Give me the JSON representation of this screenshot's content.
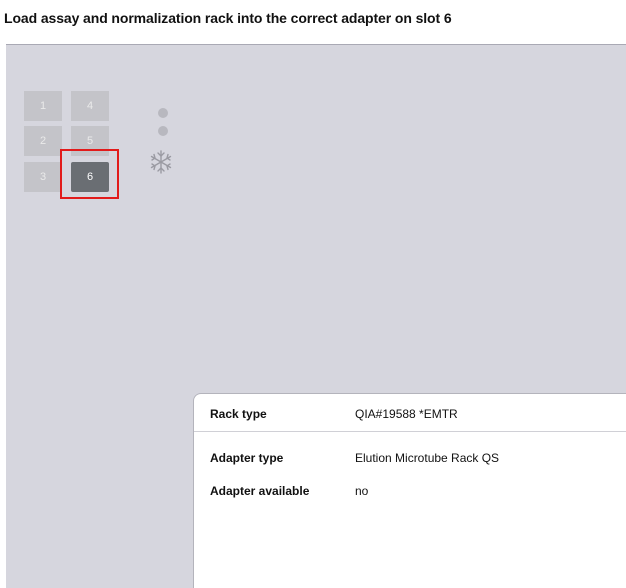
{
  "header": {
    "title": "Load assay and normalization rack into the correct adapter on slot 6"
  },
  "slots": {
    "s1": "1",
    "s2": "2",
    "s3": "3",
    "s4": "4",
    "s5": "5",
    "s6": "6",
    "selected": "6"
  },
  "cooling": {
    "icon": "snowflake-icon",
    "indicator_count": 2
  },
  "info_panel": {
    "rack_type_label": "Rack type",
    "rack_type_value": "QIA#19588 *EMTR",
    "adapter_type_label": "Adapter type",
    "adapter_type_value": "Elution Microtube Rack QS",
    "adapter_available_label": "Adapter available",
    "adapter_available_value": "no"
  },
  "colors": {
    "highlight": "#e21b1b",
    "work_area": "#d6d6de",
    "selected_slot": "#6a6e73"
  }
}
